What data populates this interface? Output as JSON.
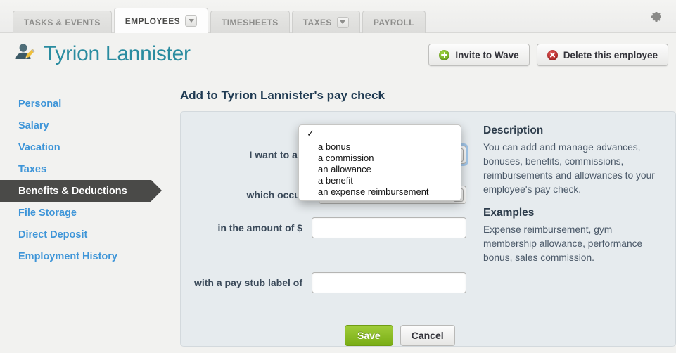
{
  "tabs": [
    {
      "label": "TASKS & EVENTS",
      "active": false,
      "caret": false
    },
    {
      "label": "EMPLOYEES",
      "active": true,
      "caret": true
    },
    {
      "label": "TIMESHEETS",
      "active": false,
      "caret": false
    },
    {
      "label": "TAXES",
      "active": false,
      "caret": true
    },
    {
      "label": "PAYROLL",
      "active": false,
      "caret": false
    }
  ],
  "header": {
    "title": "Tyrion Lannister",
    "avatar_icon": "user-edit-icon",
    "settings_icon": "gear-icon",
    "invite_label": "Invite to Wave",
    "delete_label": "Delete this employee"
  },
  "sidebar": {
    "items": [
      {
        "label": "Personal",
        "active": false
      },
      {
        "label": "Salary",
        "active": false
      },
      {
        "label": "Vacation",
        "active": false
      },
      {
        "label": "Taxes",
        "active": false
      },
      {
        "label": "Benefits & Deductions",
        "active": true
      },
      {
        "label": "File Storage",
        "active": false
      },
      {
        "label": "Direct Deposit",
        "active": false
      },
      {
        "label": "Employment History",
        "active": false
      }
    ]
  },
  "main": {
    "section_title": "Add to Tyrion Lannister's pay check",
    "fields": {
      "add_label": "I want to add",
      "add_value": "",
      "occurs_label": "which occurs",
      "occurs_value": "",
      "amount_label": "in the amount of $",
      "amount_value": "",
      "amount_placeholder": "",
      "paystub_label": "with a pay stub label of",
      "paystub_value": "",
      "paystub_placeholder": ""
    },
    "save_label": "Save",
    "cancel_label": "Cancel"
  },
  "dropdown": {
    "open": true,
    "selected_index": 0,
    "check_glyph": "✓",
    "options": [
      "",
      "a bonus",
      "a commission",
      "an allowance",
      "a benefit",
      "an expense reimbursement"
    ]
  },
  "description": {
    "heading": "Description",
    "body": "You can add and manage advances, bonuses, benefits, commissions, reimbursements and allowances to your employee's pay check.",
    "examples_heading": "Examples",
    "examples_body": "Expense reimbursement, gym membership allowance, performance bonus, sales commission."
  },
  "colors": {
    "accent_teal": "#2a8ca0",
    "link_blue": "#3e95d8",
    "active_dark": "#4a4a48",
    "save_green": "#79ad15",
    "delete_red": "#a81d1d",
    "panel_bg": "#e6ebee"
  }
}
